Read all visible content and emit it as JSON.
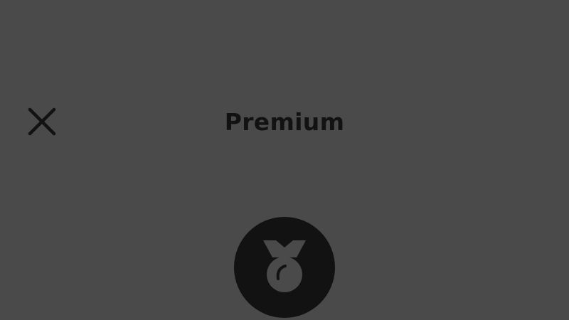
{
  "header": {
    "title": "Premium",
    "close_icon": "close-icon"
  },
  "hero": {
    "icon": "medal-icon"
  },
  "colors": {
    "background": "#4a4a4a",
    "foreground": "#121212",
    "icon_fill": "#4a4a4a"
  }
}
